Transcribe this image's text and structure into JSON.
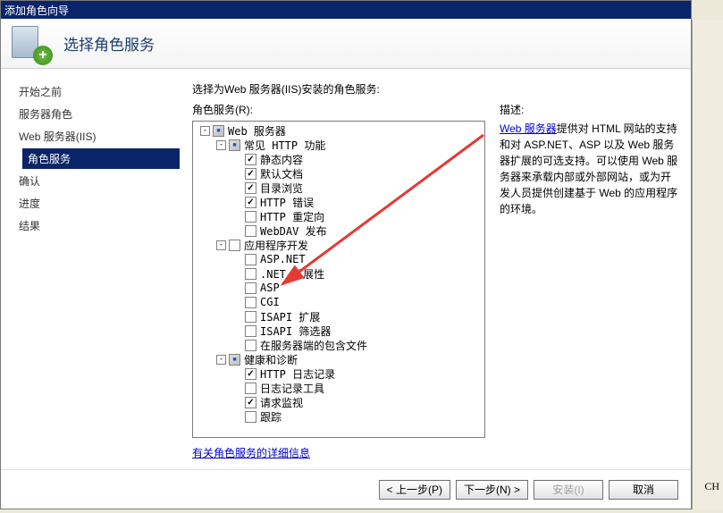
{
  "window": {
    "title": "添加角色向导"
  },
  "header": {
    "title": "选择角色服务"
  },
  "sidebar": {
    "items": [
      {
        "label": "开始之前",
        "selected": false,
        "indent": false
      },
      {
        "label": "服务器角色",
        "selected": false,
        "indent": false
      },
      {
        "label": "Web 服务器(IIS)",
        "selected": false,
        "indent": false
      },
      {
        "label": "角色服务",
        "selected": true,
        "indent": true
      },
      {
        "label": "确认",
        "selected": false,
        "indent": false
      },
      {
        "label": "进度",
        "selected": false,
        "indent": false
      },
      {
        "label": "结果",
        "selected": false,
        "indent": false
      }
    ]
  },
  "main": {
    "prompt": "选择为Web 服务器(IIS)安装的角色服务:",
    "role_services_label": "角色服务(R):",
    "desc_label": "描述:",
    "desc_link": "Web 服务器",
    "desc_text": "提供对 HTML 网站的支持和对 ASP.NET、ASP 以及 Web 服务器扩展的可选支持。可以使用 Web 服务器来承载内部或外部网站，或为开发人员提供创建基于 Web 的应用程序的环境。",
    "detail_link": "有关角色服务的详细信息",
    "tree": [
      {
        "depth": 0,
        "toggle": "-",
        "check": "partial",
        "label": "Web 服务器"
      },
      {
        "depth": 1,
        "toggle": "-",
        "check": "partial",
        "label": "常见 HTTP 功能"
      },
      {
        "depth": 2,
        "toggle": "",
        "check": "checked",
        "label": "静态内容"
      },
      {
        "depth": 2,
        "toggle": "",
        "check": "checked",
        "label": "默认文档"
      },
      {
        "depth": 2,
        "toggle": "",
        "check": "checked",
        "label": "目录浏览"
      },
      {
        "depth": 2,
        "toggle": "",
        "check": "checked",
        "label": "HTTP 错误"
      },
      {
        "depth": 2,
        "toggle": "",
        "check": "none",
        "label": "HTTP 重定向"
      },
      {
        "depth": 2,
        "toggle": "",
        "check": "none",
        "label": "WebDAV 发布"
      },
      {
        "depth": 1,
        "toggle": "-",
        "check": "none",
        "label": "应用程序开发"
      },
      {
        "depth": 2,
        "toggle": "",
        "check": "none",
        "label": "ASP.NET"
      },
      {
        "depth": 2,
        "toggle": "",
        "check": "none",
        "label": ".NET 扩展性"
      },
      {
        "depth": 2,
        "toggle": "",
        "check": "none",
        "label": "ASP"
      },
      {
        "depth": 2,
        "toggle": "",
        "check": "none",
        "label": "CGI"
      },
      {
        "depth": 2,
        "toggle": "",
        "check": "none",
        "label": "ISAPI 扩展"
      },
      {
        "depth": 2,
        "toggle": "",
        "check": "none",
        "label": "ISAPI 筛选器"
      },
      {
        "depth": 2,
        "toggle": "",
        "check": "none",
        "label": "在服务器端的包含文件"
      },
      {
        "depth": 1,
        "toggle": "-",
        "check": "partial",
        "label": "健康和诊断"
      },
      {
        "depth": 2,
        "toggle": "",
        "check": "checked",
        "label": "HTTP 日志记录"
      },
      {
        "depth": 2,
        "toggle": "",
        "check": "none",
        "label": "日志记录工具"
      },
      {
        "depth": 2,
        "toggle": "",
        "check": "checked",
        "label": "请求监视"
      },
      {
        "depth": 2,
        "toggle": "",
        "check": "none",
        "label": "跟踪"
      }
    ]
  },
  "buttons": {
    "prev": "< 上一步(P)",
    "next": "下一步(N) >",
    "install": "安装(I)",
    "cancel": "取消"
  },
  "misc": {
    "ch": "CH"
  }
}
